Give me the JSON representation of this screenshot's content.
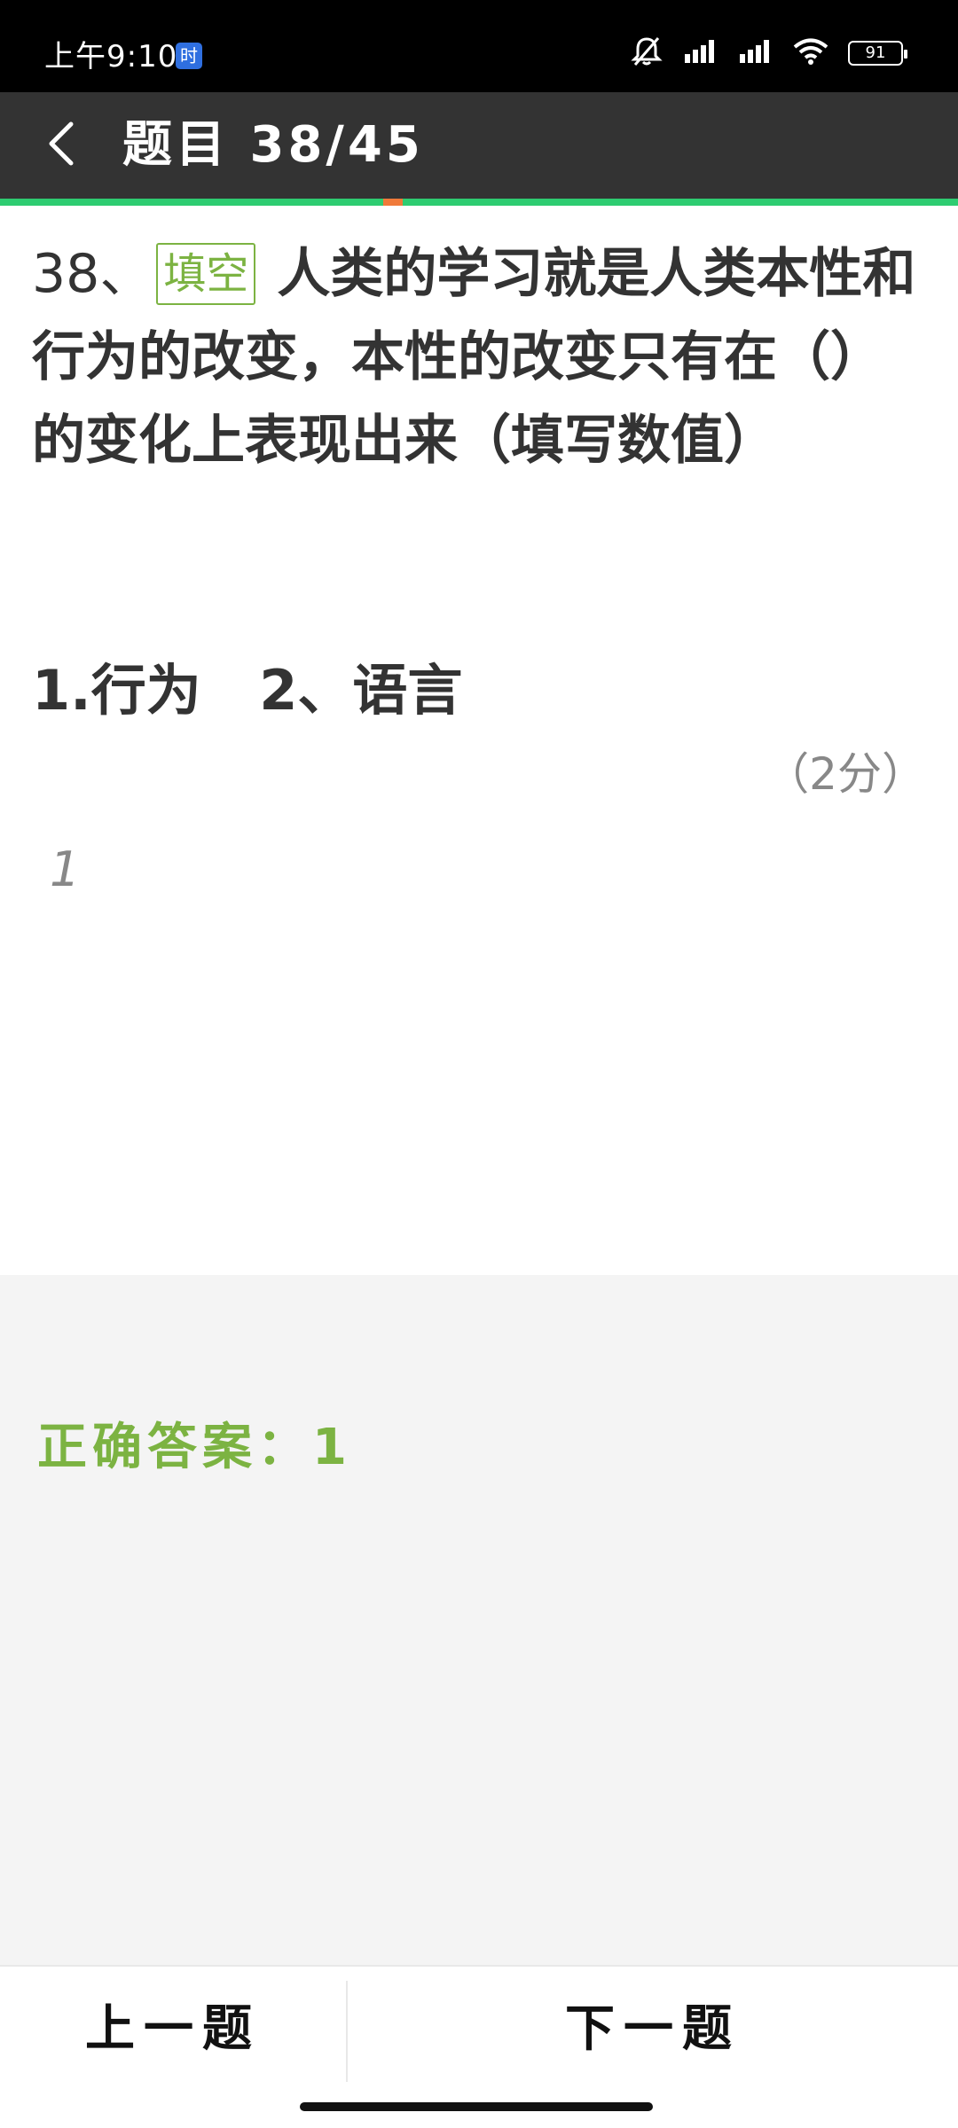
{
  "status_bar": {
    "time": "上午9:10",
    "badge": "时",
    "battery": "91"
  },
  "app_bar": {
    "title": "题目 38/45"
  },
  "question": {
    "number": "38、",
    "type_tag": "填空",
    "text": "人类的学习就是人类本性和行为的改变，本性的改变只有在（）的变化上表现出来（填写数值）",
    "options": [
      "1.行为",
      "2、语言"
    ],
    "score": "（2分）",
    "user_answer": "1"
  },
  "answer_panel": {
    "correct_answer": "正确答案：1"
  },
  "bottom_nav": {
    "prev_label": "上一题",
    "next_label": "下一题"
  },
  "colors": {
    "app_bar": "#333333",
    "progress": "#2ecc71",
    "progress_marker": "#f07a3a",
    "accent_green": "#7cb342",
    "panel": "#f4f4f4"
  },
  "icons": {
    "back": "chevron-left-icon",
    "mute": "bell-off-icon",
    "signal": "signal-icon",
    "wifi": "wifi-icon",
    "battery": "battery-icon"
  }
}
